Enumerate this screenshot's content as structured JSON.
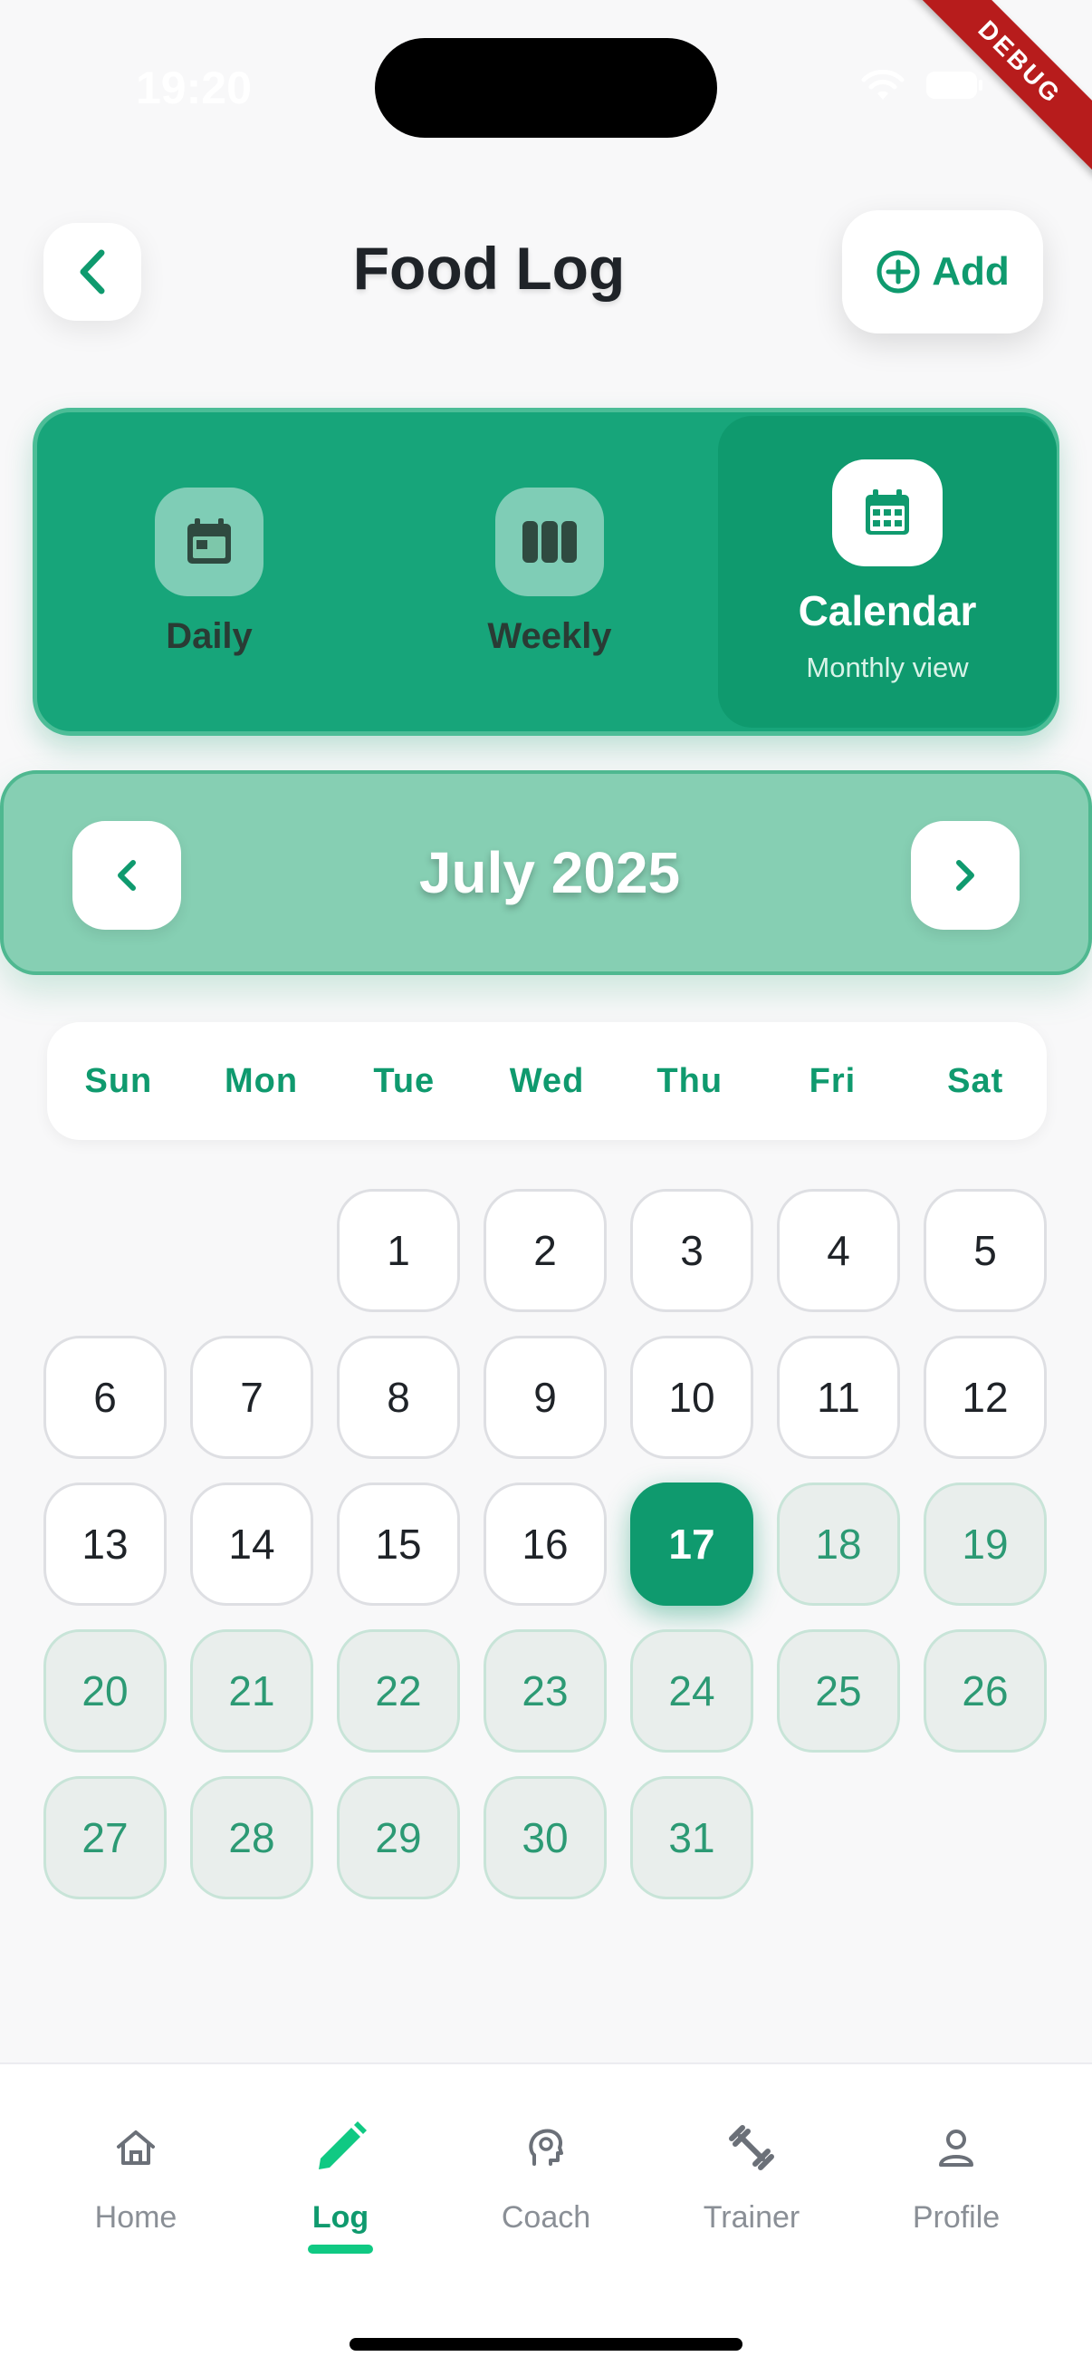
{
  "status_bar": {
    "time": "19:20"
  },
  "debug_ribbon": "DEBUG",
  "header": {
    "title": "Food Log",
    "add_label": "Add"
  },
  "view_selector": {
    "daily": {
      "label": "Daily"
    },
    "weekly": {
      "label": "Weekly"
    },
    "calendar": {
      "label": "Calendar",
      "sub": "Monthly view",
      "active": true
    }
  },
  "month_nav": {
    "title": "July 2025"
  },
  "weekdays": [
    "Sun",
    "Mon",
    "Tue",
    "Wed",
    "Thu",
    "Fri",
    "Sat"
  ],
  "calendar": {
    "first_weekday_index": 2,
    "days_in_month": 31,
    "today": 17,
    "days": [
      "1",
      "2",
      "3",
      "4",
      "5",
      "6",
      "7",
      "8",
      "9",
      "10",
      "11",
      "12",
      "13",
      "14",
      "15",
      "16",
      "17",
      "18",
      "19",
      "20",
      "21",
      "22",
      "23",
      "24",
      "25",
      "26",
      "27",
      "28",
      "29",
      "30",
      "31"
    ]
  },
  "bottom_nav": {
    "items": [
      {
        "label": "Home",
        "icon": "home-icon"
      },
      {
        "label": "Log",
        "icon": "pencil-icon",
        "active": true
      },
      {
        "label": "Coach",
        "icon": "coach-icon"
      },
      {
        "label": "Trainer",
        "icon": "dumbbell-icon"
      },
      {
        "label": "Profile",
        "icon": "person-icon"
      }
    ]
  },
  "colors": {
    "accent": "#0f9a6e",
    "selector_bg": "#17a57a",
    "month_bg": "#86cfb3",
    "future_day_text": "#2c9a74"
  }
}
